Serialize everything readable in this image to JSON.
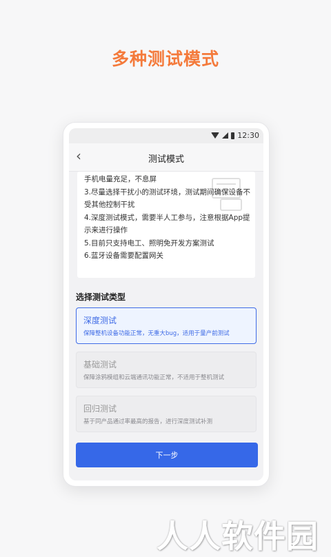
{
  "headline": "多种测试模式",
  "status_bar": {
    "time": "12:30",
    "icons": [
      "wifi-icon",
      "signal-icon",
      "battery-icon"
    ]
  },
  "nav": {
    "title": "测试模式",
    "back_icon": "chevron-left-icon"
  },
  "notes": [
    "手机电量充足，不息屏",
    "3.尽量选择干扰小的测试环境，测试期间确保设备不",
    "受其他控制干扰",
    "4.深度测试模式，需要半人工参与，注意根据App提",
    "示来进行操作",
    "5.目前只支持电工、照明免开发方案测试",
    "6.蓝牙设备需要配置网关"
  ],
  "section_title": "选择测试类型",
  "options": [
    {
      "title": "深度测试",
      "desc": "保障整机设备功能正常，无重大bug，适用于量产前测试",
      "selected": true
    },
    {
      "title": "基础测试",
      "desc": "保障涂鸦模组和云端通讯功能正常，不适用于整机测试",
      "selected": false
    },
    {
      "title": "回归测试",
      "desc": "基于同产品通过率最高的报告，进行深度测试补测",
      "selected": false
    }
  ],
  "next_button": "下一步",
  "watermark": "人人软件园",
  "colors": {
    "accent": "#f47a3b",
    "primary": "#3668e8",
    "selected_border": "#3f6be6"
  }
}
